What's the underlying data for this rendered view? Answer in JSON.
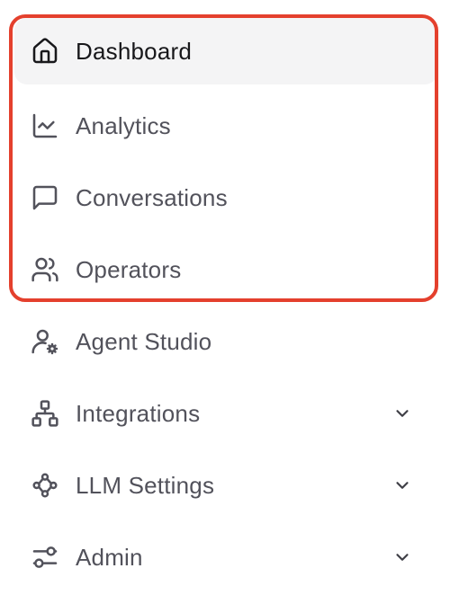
{
  "sidebar": {
    "items": [
      {
        "label": "Dashboard",
        "icon": "home-icon",
        "active": true
      },
      {
        "label": "Analytics",
        "icon": "chart-line-icon"
      },
      {
        "label": "Conversations",
        "icon": "message-square-icon"
      },
      {
        "label": "Operators",
        "icon": "users-icon"
      },
      {
        "label": "Agent Studio",
        "icon": "user-cog-icon"
      },
      {
        "label": "Integrations",
        "icon": "network-icon",
        "expandable": true
      },
      {
        "label": "LLM Settings",
        "icon": "workflow-icon",
        "expandable": true
      },
      {
        "label": "Admin",
        "icon": "sliders-icon",
        "expandable": true
      }
    ]
  },
  "colors": {
    "highlight_border": "#e4402d",
    "active_background": "#f4f4f5",
    "text_active": "#18181b",
    "text_default": "#52525b"
  }
}
